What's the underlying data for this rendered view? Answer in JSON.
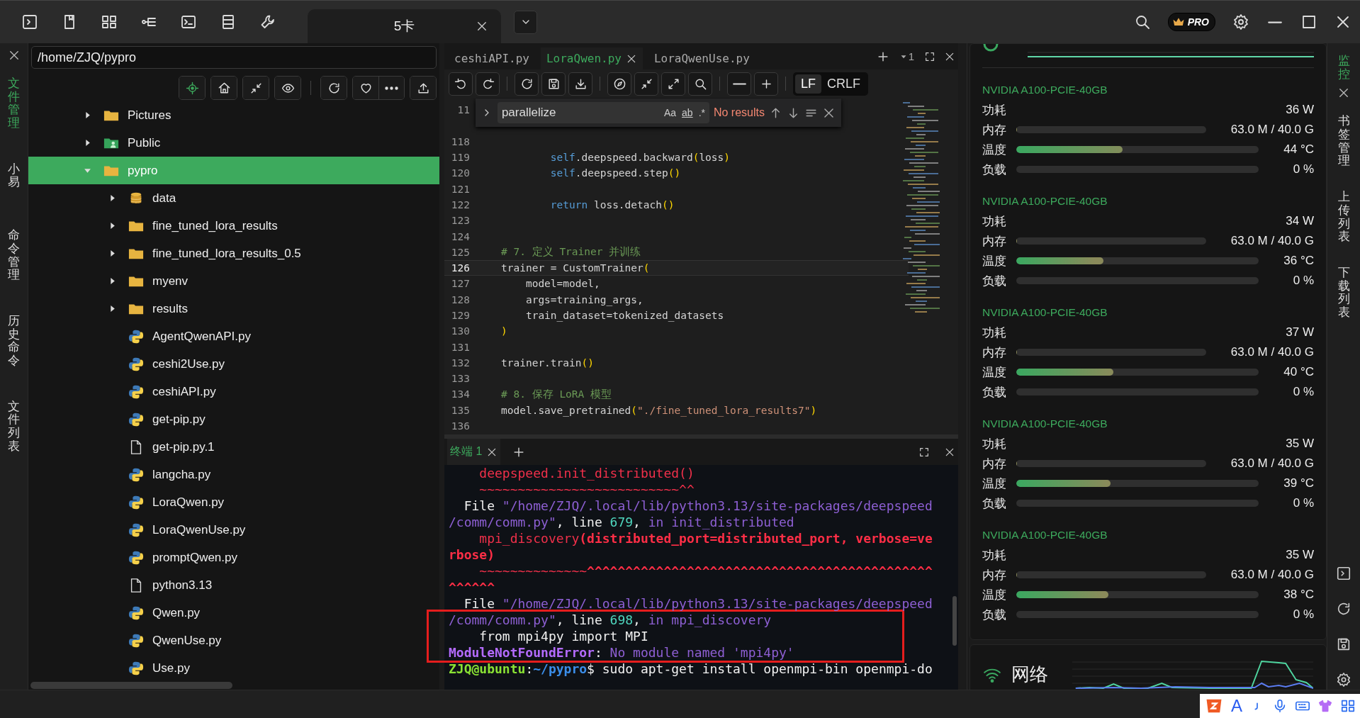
{
  "session_tab": {
    "title": "5卡"
  },
  "top_right": {
    "badge": "PRO"
  },
  "left_rail": [
    {
      "label": "文件管理",
      "selected": true
    },
    {
      "label": "小易",
      "selected": false
    },
    {
      "label": "命令管理",
      "selected": false
    },
    {
      "label": "历史命令",
      "selected": false
    },
    {
      "label": "文件列表",
      "selected": false
    }
  ],
  "file_panel": {
    "path": "/home/ZJQ/pypro",
    "tree": [
      {
        "name": "Pictures",
        "kind": "folder",
        "expanded": false,
        "selected": false
      },
      {
        "name": "Public",
        "kind": "public",
        "expanded": false,
        "selected": false
      },
      {
        "name": "pypro",
        "kind": "folder",
        "expanded": true,
        "selected": true,
        "children": [
          {
            "name": "data",
            "kind": "data",
            "expanded": false,
            "selected": false
          },
          {
            "name": "fine_tuned_lora_results",
            "kind": "folder",
            "expanded": false,
            "selected": false
          },
          {
            "name": "fine_tuned_lora_results_0.5",
            "kind": "folder",
            "expanded": false,
            "selected": false
          },
          {
            "name": "myenv",
            "kind": "folder",
            "expanded": false,
            "selected": false
          },
          {
            "name": "results",
            "kind": "folder",
            "expanded": false,
            "selected": false
          },
          {
            "name": "AgentQwenAPI.py",
            "kind": "python",
            "selected": false
          },
          {
            "name": "ceshi2Use.py",
            "kind": "python",
            "selected": false
          },
          {
            "name": "ceshiAPI.py",
            "kind": "python",
            "selected": false
          },
          {
            "name": "get-pip.py",
            "kind": "python",
            "selected": false
          },
          {
            "name": "get-pip.py.1",
            "kind": "file",
            "selected": false
          },
          {
            "name": "langcha.py",
            "kind": "python",
            "selected": false
          },
          {
            "name": "LoraQwen.py",
            "kind": "python",
            "selected": false
          },
          {
            "name": "LoraQwenUse.py",
            "kind": "python",
            "selected": false
          },
          {
            "name": "promptQwen.py",
            "kind": "python",
            "selected": false
          },
          {
            "name": "python3.13",
            "kind": "file",
            "selected": false
          },
          {
            "name": "Qwen.py",
            "kind": "python",
            "selected": false
          },
          {
            "name": "QwenUse.py",
            "kind": "python",
            "selected": false
          },
          {
            "name": "Use.py",
            "kind": "python",
            "selected": false
          }
        ]
      }
    ]
  },
  "editor": {
    "tabs": [
      {
        "label": "ceshiAPI.py",
        "selected": false
      },
      {
        "label": "LoraQwen.py",
        "selected": true
      },
      {
        "label": "LoraQwenUse.py",
        "selected": false
      }
    ],
    "split_count": "1",
    "eol": [
      {
        "label": "LF",
        "selected": true
      },
      {
        "label": "CRLF",
        "selected": false
      }
    ],
    "find": {
      "value": "parallelize",
      "options": [
        "Aa",
        "ab",
        ".*"
      ],
      "status": "No results"
    },
    "lines": [
      {
        "number": "11",
        "current": false
      },
      {
        "number": "118",
        "current": false
      },
      {
        "number": "119",
        "current": false,
        "tokens": [
          {
            "kind": "self",
            "text": "        self"
          },
          {
            "kind": "plain",
            "text": ".deepspeed.backward"
          },
          {
            "kind": "paren",
            "text": "("
          },
          {
            "kind": "plain",
            "text": "loss"
          },
          {
            "kind": "paren",
            "text": ")"
          }
        ]
      },
      {
        "number": "120",
        "current": false,
        "tokens": [
          {
            "kind": "self",
            "text": "        self"
          },
          {
            "kind": "plain",
            "text": ".deepspeed.step"
          },
          {
            "kind": "paren",
            "text": "()"
          }
        ]
      },
      {
        "number": "121",
        "current": false
      },
      {
        "number": "122",
        "current": false,
        "tokens": [
          {
            "kind": "keyword",
            "text": "        return"
          },
          {
            "kind": "plain",
            "text": " loss.detach"
          },
          {
            "kind": "paren",
            "text": "()"
          }
        ]
      },
      {
        "number": "123",
        "current": false
      },
      {
        "number": "124",
        "current": false
      },
      {
        "number": "125",
        "current": false,
        "tokens": [
          {
            "kind": "comment",
            "text": "# 7. 定义 Trainer 并训练"
          }
        ]
      },
      {
        "number": "126",
        "current": true,
        "tokens": [
          {
            "kind": "plain",
            "text": "trainer = CustomTrainer"
          },
          {
            "kind": "paren",
            "text": "("
          }
        ]
      },
      {
        "number": "127",
        "current": false,
        "tokens": [
          {
            "kind": "plain",
            "text": "    model=model,"
          }
        ]
      },
      {
        "number": "128",
        "current": false,
        "tokens": [
          {
            "kind": "plain",
            "text": "    args=training_args,"
          }
        ]
      },
      {
        "number": "129",
        "current": false,
        "tokens": [
          {
            "kind": "plain",
            "text": "    train_dataset=tokenized_datasets"
          }
        ]
      },
      {
        "number": "130",
        "current": false,
        "tokens": [
          {
            "kind": "paren",
            "text": ")"
          }
        ]
      },
      {
        "number": "131",
        "current": false
      },
      {
        "number": "132",
        "current": false,
        "tokens": [
          {
            "kind": "plain",
            "text": "trainer.train"
          },
          {
            "kind": "paren",
            "text": "()"
          }
        ]
      },
      {
        "number": "133",
        "current": false
      },
      {
        "number": "134",
        "current": false,
        "tokens": [
          {
            "kind": "comment",
            "text": "# 8. 保存 LoRA 模型"
          }
        ]
      },
      {
        "number": "135",
        "current": false,
        "tokens": [
          {
            "kind": "plain",
            "text": "model.save_pretrained"
          },
          {
            "kind": "paren",
            "text": "("
          },
          {
            "kind": "string",
            "text": "\"./fine_tuned_lora_results7\""
          },
          {
            "kind": "paren",
            "text": ")"
          }
        ]
      },
      {
        "number": "136",
        "current": false
      }
    ]
  },
  "terminal": {
    "tab": {
      "label": "终端 1",
      "selected": true
    },
    "blocks": [
      {
        "boxed": false,
        "lines": [
          [
            {
              "kind": "err",
              "text": "    deepspeed.init_distributed()"
            }
          ],
          [
            {
              "kind": "err",
              "text": "    ~~~~~~~~~~~~~~~~~~~~~~~~~~^^"
            }
          ],
          [
            {
              "kind": "plain",
              "text": "  File "
            },
            {
              "kind": "path",
              "text": "\"/home/ZJQ/.local/lib/python3.13/site-packages/deepspeed"
            }
          ],
          [
            {
              "kind": "path",
              "text": "/comm/comm.py\""
            },
            {
              "kind": "plain",
              "text": ", line "
            },
            {
              "kind": "num",
              "text": "679"
            },
            {
              "kind": "plain",
              "text": ", "
            },
            {
              "kind": "path",
              "text": "in init_distributed"
            }
          ],
          [
            {
              "kind": "err",
              "text": "    mpi_discovery"
            },
            {
              "kind": "errb",
              "text": "(distributed_port=distributed_port, verbose=ve"
            }
          ],
          [
            {
              "kind": "errb",
              "text": "rbose)"
            }
          ],
          [
            {
              "kind": "err",
              "text": "    ~~~~~~~~~~~~~~"
            },
            {
              "kind": "errb",
              "text": "^^^^^^^^^^^^^^^^^^^^^^^^^^^^^^^^^^^^^^^^^^^^^"
            }
          ],
          [
            {
              "kind": "errb",
              "text": "^^^^^^"
            }
          ],
          [
            {
              "kind": "plain",
              "text": "  File "
            },
            {
              "kind": "path",
              "text": "\"/home/ZJQ/.local/lib/python3.13/site-packages/deepspeed"
            }
          ]
        ]
      },
      {
        "boxed": true,
        "lines": [
          [
            {
              "kind": "path",
              "text": "/comm/comm.py\""
            },
            {
              "kind": "plain",
              "text": ", line "
            },
            {
              "kind": "num",
              "text": "698"
            },
            {
              "kind": "plain",
              "text": ", "
            },
            {
              "kind": "path",
              "text": "in mpi_discovery"
            }
          ],
          [
            {
              "kind": "plain",
              "text": "    from mpi4py import MPI"
            }
          ],
          [
            {
              "kind": "errname",
              "text": "ModuleNotFoundError"
            },
            {
              "kind": "plain",
              "text": ": "
            },
            {
              "kind": "path",
              "text": "No module named 'mpi4py'"
            }
          ]
        ]
      },
      {
        "boxed": false,
        "lines": [
          [
            {
              "kind": "user",
              "text": "ZJQ@ubuntu"
            },
            {
              "kind": "plain",
              "text": ":"
            },
            {
              "kind": "cwd",
              "text": "~/pypro"
            },
            {
              "kind": "plain",
              "text": "$ sudo apt-get install openmpi-bin openmpi-do"
            }
          ]
        ]
      }
    ]
  },
  "monitor": {
    "gpus": [
      {
        "name": "NVIDIA A100-PCIE-40GB",
        "metrics": [
          {
            "kind": "value",
            "label": "功耗",
            "reading": "36 W"
          },
          {
            "kind": "short-bar",
            "label": "内存",
            "level": 0.005,
            "reading": "63.0 M / 40.0 G"
          },
          {
            "kind": "bar",
            "label": "温度",
            "level": 0.44,
            "reading": "44 °C"
          },
          {
            "kind": "bar",
            "label": "负载",
            "level": 0,
            "reading": "0 %"
          }
        ]
      },
      {
        "name": "NVIDIA A100-PCIE-40GB",
        "metrics": [
          {
            "kind": "value",
            "label": "功耗",
            "reading": "34 W"
          },
          {
            "kind": "short-bar",
            "label": "内存",
            "level": 0.005,
            "reading": "63.0 M / 40.0 G"
          },
          {
            "kind": "bar",
            "label": "温度",
            "level": 0.36,
            "reading": "36 °C"
          },
          {
            "kind": "bar",
            "label": "负载",
            "level": 0,
            "reading": "0 %"
          }
        ]
      },
      {
        "name": "NVIDIA A100-PCIE-40GB",
        "metrics": [
          {
            "kind": "value",
            "label": "功耗",
            "reading": "37 W"
          },
          {
            "kind": "short-bar",
            "label": "内存",
            "level": 0.005,
            "reading": "63.0 M / 40.0 G"
          },
          {
            "kind": "bar",
            "label": "温度",
            "level": 0.4,
            "reading": "40 °C"
          },
          {
            "kind": "bar",
            "label": "负载",
            "level": 0,
            "reading": "0 %"
          }
        ]
      },
      {
        "name": "NVIDIA A100-PCIE-40GB",
        "metrics": [
          {
            "kind": "value",
            "label": "功耗",
            "reading": "35 W"
          },
          {
            "kind": "short-bar",
            "label": "内存",
            "level": 0.005,
            "reading": "63.0 M / 40.0 G"
          },
          {
            "kind": "bar",
            "label": "温度",
            "level": 0.39,
            "reading": "39 °C"
          },
          {
            "kind": "bar",
            "label": "负载",
            "level": 0,
            "reading": "0 %"
          }
        ]
      },
      {
        "name": "NVIDIA A100-PCIE-40GB",
        "metrics": [
          {
            "kind": "value",
            "label": "功耗",
            "reading": "35 W"
          },
          {
            "kind": "short-bar",
            "label": "内存",
            "level": 0.005,
            "reading": "63.0 M / 40.0 G"
          },
          {
            "kind": "bar",
            "label": "温度",
            "level": 0.38,
            "reading": "38 °C"
          },
          {
            "kind": "bar",
            "label": "负载",
            "level": 0,
            "reading": "0 %"
          }
        ]
      }
    ],
    "network": {
      "label": "网络"
    }
  },
  "right_rail": [
    {
      "label": "监控",
      "selected": true
    },
    {
      "label": "书签管理",
      "selected": false
    },
    {
      "label": "上传列表",
      "selected": false
    },
    {
      "label": "下载列表",
      "selected": false
    }
  ],
  "ime_toolbar": {
    "mode": "A"
  }
}
